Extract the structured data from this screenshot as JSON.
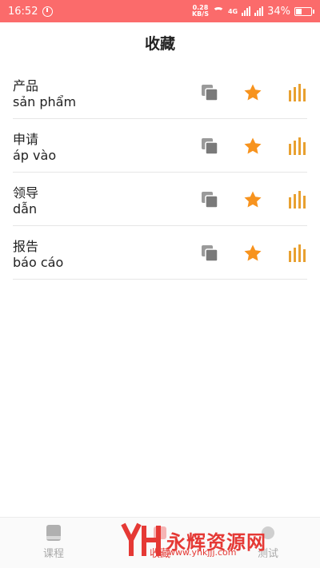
{
  "status": {
    "time": "16:52",
    "net_value": "0.28",
    "net_unit": "KB/S",
    "signal_label": "4G",
    "battery": "34%"
  },
  "page_title": "收藏",
  "items": [
    {
      "zh": "产品",
      "vi": "sản phẩm"
    },
    {
      "zh": "申请",
      "vi": "áp vào"
    },
    {
      "zh": "领导",
      "vi": "dẫn"
    },
    {
      "zh": "报告",
      "vi": "báo cáo"
    }
  ],
  "tabs": {
    "course": "课程",
    "favorites": "收藏",
    "exercise": "测试"
  },
  "watermark": {
    "text": "永辉资源网",
    "url": "www.yhkjjj.com"
  },
  "colors": {
    "status_bar": "#fb6b6b",
    "star": "#f7931e",
    "audio": "#e8a030",
    "copy": "#7a7a7a",
    "active_tab": "#e53935"
  },
  "icons": {
    "copy": "copy-icon",
    "star": "star-icon",
    "audio": "audio-bars-icon",
    "book": "book-icon"
  }
}
